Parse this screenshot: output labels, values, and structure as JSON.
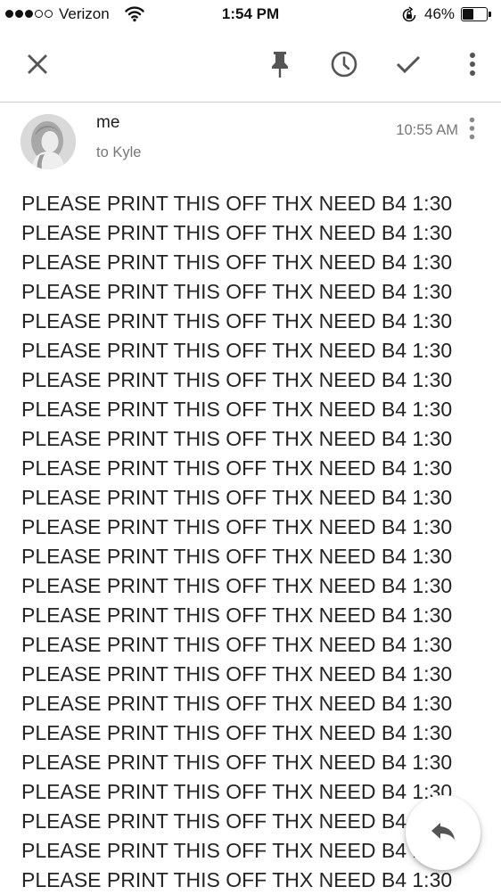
{
  "status_bar": {
    "signal_filled": 3,
    "signal_total": 5,
    "carrier": "Verizon",
    "time": "1:54 PM",
    "battery_percent": "46%",
    "battery_level": 0.46
  },
  "toolbar": {
    "icons": [
      "close-icon",
      "pin-icon",
      "snooze-icon",
      "done-icon",
      "more-vert-icon"
    ]
  },
  "message": {
    "sender": "me",
    "recipient": "to Kyle",
    "time": "10:55 AM",
    "body_lines": [
      "PLEASE PRINT THIS OFF THX NEED B4 1:30",
      "PLEASE PRINT THIS OFF THX NEED B4 1:30",
      "PLEASE PRINT THIS OFF THX NEED B4 1:30",
      "PLEASE PRINT THIS OFF THX NEED B4 1:30",
      "PLEASE PRINT THIS OFF THX NEED B4 1:30",
      "PLEASE PRINT THIS OFF THX NEED B4 1:30",
      "PLEASE PRINT THIS OFF THX NEED B4 1:30",
      "PLEASE PRINT THIS OFF THX NEED B4 1:30",
      "PLEASE PRINT THIS OFF THX NEED B4 1:30",
      "PLEASE PRINT THIS OFF THX NEED B4 1:30",
      "PLEASE PRINT THIS OFF THX NEED B4 1:30",
      "PLEASE PRINT THIS OFF THX NEED B4 1:30",
      "PLEASE PRINT THIS OFF THX NEED B4 1:30",
      "PLEASE PRINT THIS OFF THX NEED B4 1:30",
      "PLEASE PRINT THIS OFF THX NEED B4 1:30",
      "PLEASE PRINT THIS OFF THX NEED B4 1:30",
      "PLEASE PRINT THIS OFF THX NEED B4 1:30",
      "PLEASE PRINT THIS OFF THX NEED B4 1:30",
      "PLEASE PRINT THIS OFF THX NEED B4 1:30",
      "PLEASE PRINT THIS OFF THX NEED B4 1:30",
      "PLEASE PRINT THIS OFF THX NEED B4 1:30",
      "PLEASE PRINT THIS OFF THX NEED B4 1:30",
      "PLEASE PRINT THIS OFF THX NEED B4 1:30",
      "PLEASE PRINT THIS OFF THX NEED B4 1:30"
    ]
  },
  "fab": {
    "icon": "reply-icon"
  },
  "colors": {
    "icon": "#555555",
    "text": "#242424",
    "secondary_text": "#777777",
    "divider": "#cfcfcf"
  }
}
